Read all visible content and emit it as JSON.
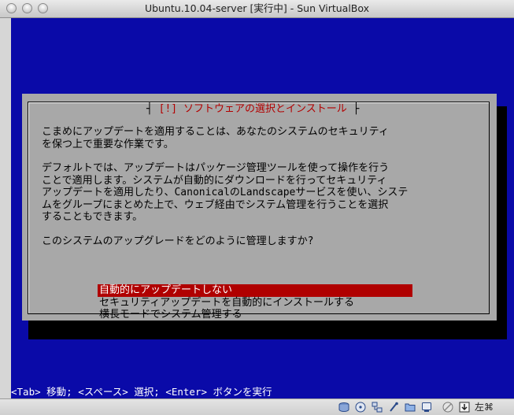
{
  "window": {
    "title": "Ubuntu.10.04-server [実行中] - Sun VirtualBox"
  },
  "installer": {
    "dialog_title": "[!] ソフトウェアの選択とインストール",
    "paragraphs": [
      "こまめにアップデートを適用することは、あなたのシステムのセキュリティ\nを保つ上で重要な作業です。",
      "デフォルトでは、アップデートはパッケージ管理ツールを使って操作を行う\nことで適用します。システムが自動的にダウンロードを行ってセキュリティ\nアップデートを適用したり、CanonicalのLandscapeサービスを使い、システ\nムをグループにまとめた上で、ウェブ経由でシステム管理を行うことを選択\nすることもできます。",
      "このシステムのアップグレードをどのように管理しますか?"
    ],
    "options": [
      {
        "label": "自動的にアップデートしない",
        "selected": true
      },
      {
        "label": "セキュリティアップデートを自動的にインストールする",
        "selected": false
      },
      {
        "label": "横長モードでシステム管理する",
        "selected": false
      }
    ],
    "hint": "<Tab> 移動; <スペース> 選択; <Enter> ボタンを実行"
  },
  "statusbar": {
    "icons": [
      "hard-disk-icon",
      "optical-drive-icon",
      "network-icon",
      "usb-icon",
      "shared-folder-icon",
      "display-icon",
      "mouse-integration-icon",
      "host-key-arrow-icon"
    ],
    "host_key": "左⌘"
  },
  "colors": {
    "screen_bg": "#0a0aa8",
    "dialog_bg": "#a8a8a8",
    "title_red": "#b30000",
    "selection_bg": "#b00000"
  }
}
